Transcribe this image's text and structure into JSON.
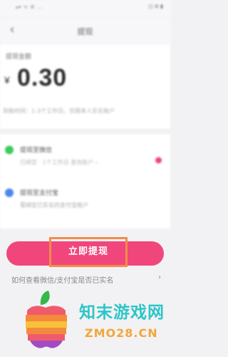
{
  "status_bar": {
    "left": "▴▾ ᯤ ⚙ ...",
    "right": "◫ ⊞ ▮"
  },
  "nav": {
    "back_icon": "‹",
    "title": "提现"
  },
  "balance": {
    "label": "提现金额",
    "currency": "¥",
    "amount": "0.30"
  },
  "note": "到账时间：1-3个工作日，仅限本人实名账户",
  "methods": [
    {
      "icon": "wechat-icon",
      "color": "#3ecb5a",
      "title": "提现至微信",
      "subtitle": "已绑定 · 1个工作日 更改账户 ›",
      "selected": true
    },
    {
      "icon": "alipay-icon",
      "color": "#4a86ee",
      "title": "提现至支付宝",
      "subtitle": "需绑定已实名的支付宝账户",
      "selected": false
    }
  ],
  "submit": {
    "label": "立即提现"
  },
  "help": {
    "text": "如何查看微信/支付宝是否已实名",
    "chevron": "›"
  },
  "watermark": {
    "name": "知末游戏网",
    "url": "ZMO28.CN"
  },
  "colors": {
    "accent": "#f1467c",
    "highlight": "#f38b4a",
    "watermark_text": "#2cc5c8",
    "watermark_url": "#f3a63b"
  }
}
